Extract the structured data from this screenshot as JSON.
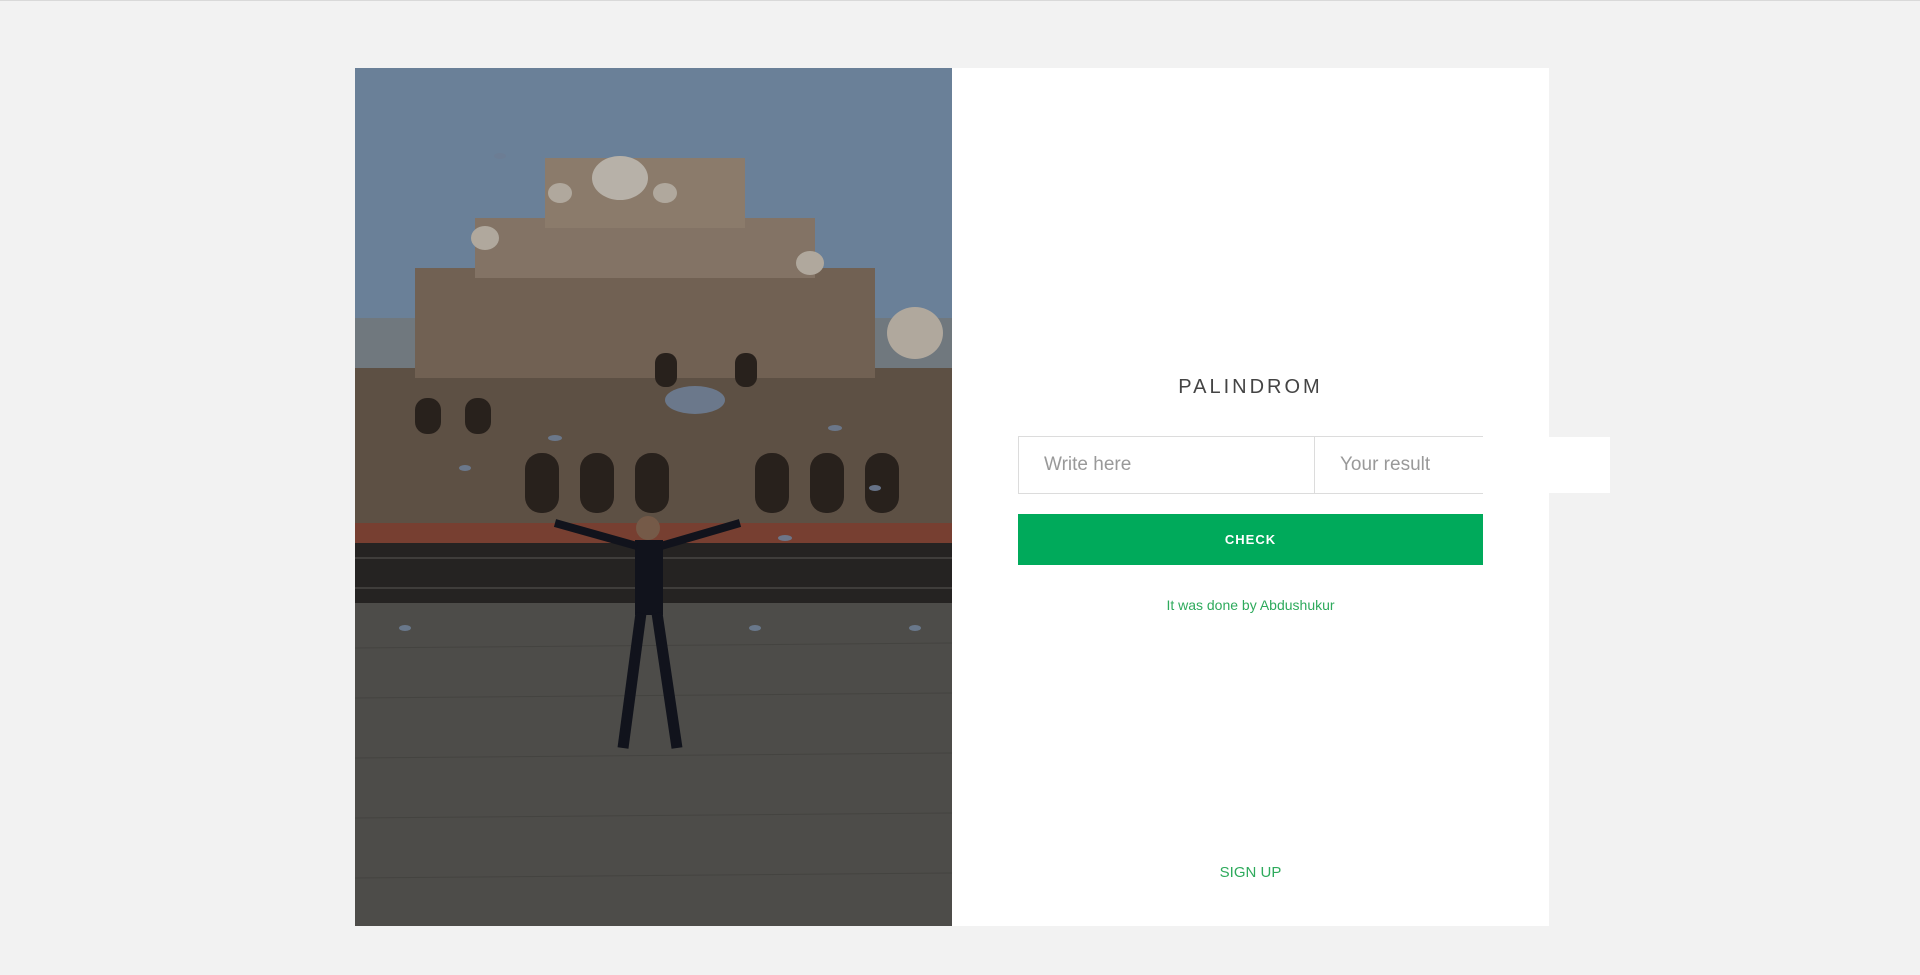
{
  "form": {
    "title": "PALINDROM",
    "input_placeholder": "Write here",
    "result_placeholder": "Your result",
    "check_label": "CHECK",
    "credit_text": "It was done by Abdushukur",
    "signup_label": "SIGN UP"
  },
  "colors": {
    "page_background": "#f2f2f2",
    "card_background": "#ffffff",
    "accent": "#00aa5b",
    "link": "#2eaa5c"
  }
}
